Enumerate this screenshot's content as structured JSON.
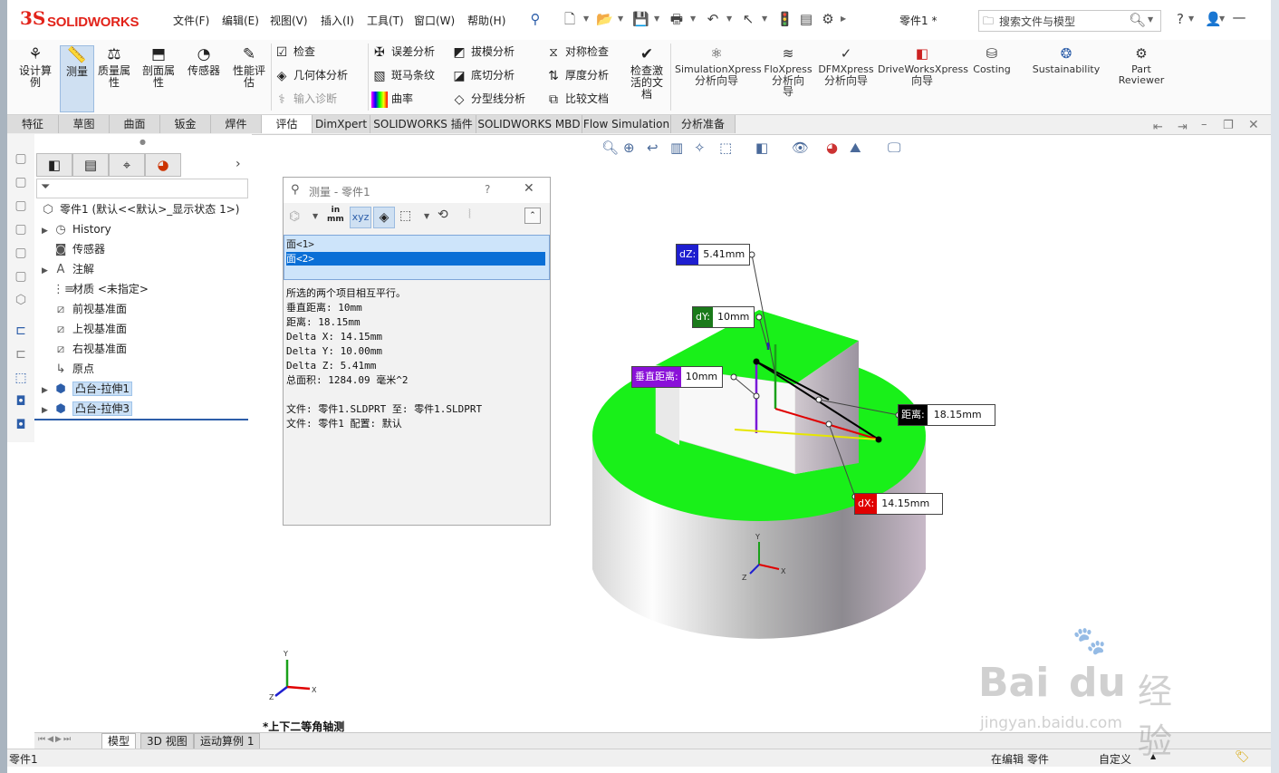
{
  "app": {
    "logo_prefix": "3S",
    "logo_text": "SOLIDWORKS",
    "document_title": "零件1 *"
  },
  "menu": [
    "文件(F)",
    "编辑(E)",
    "视图(V)",
    "插入(I)",
    "工具(T)",
    "窗口(W)",
    "帮助(H)"
  ],
  "search": {
    "placeholder": "搜索文件与模型"
  },
  "help_label": "?",
  "command_manager": {
    "big_buttons": [
      {
        "label": "设计算例",
        "icon": "design-study-icon"
      },
      {
        "label": "测量",
        "icon": "measure-icon"
      },
      {
        "label": "质量属性",
        "icon": "mass-properties-icon"
      },
      {
        "label": "剖面属性",
        "icon": "section-properties-icon"
      },
      {
        "label": "传感器",
        "icon": "sensor-icon"
      },
      {
        "label": "性能评估",
        "icon": "performance-evaluation-icon"
      }
    ],
    "small_buttons": [
      {
        "label": "检查",
        "icon": "check-icon"
      },
      {
        "label": "几何体分析",
        "icon": "geometry-analysis-icon"
      },
      {
        "label": "输入诊断",
        "icon": "import-diagnostics-icon"
      },
      {
        "label": "误差分析",
        "icon": "deviation-analysis-icon"
      },
      {
        "label": "斑马条纹",
        "icon": "zebra-stripes-icon"
      },
      {
        "label": "曲率",
        "icon": "curvature-icon"
      },
      {
        "label": "拔模分析",
        "icon": "draft-analysis-icon"
      },
      {
        "label": "底切分析",
        "icon": "undercut-analysis-icon"
      },
      {
        "label": "分型线分析",
        "icon": "parting-line-analysis-icon"
      },
      {
        "label": "对称检查",
        "icon": "symmetry-check-icon"
      },
      {
        "label": "厚度分析",
        "icon": "thickness-analysis-icon"
      },
      {
        "label": "比较文档",
        "icon": "compare-documents-icon"
      }
    ],
    "check_active_doc": "检查激活的文档",
    "extensions": [
      {
        "label": "SimulationXpress",
        "sub": "分析向导"
      },
      {
        "label": "FloXpress",
        "sub": "分析向导"
      },
      {
        "label": "DFMXpress",
        "sub": "分析向导"
      },
      {
        "label": "DriveWorksXpress",
        "sub": "向导"
      },
      {
        "label": "Costing",
        "sub": ""
      },
      {
        "label": "Sustainability",
        "sub": ""
      },
      {
        "label": "Part",
        "sub": "Reviewer"
      }
    ]
  },
  "tabs": [
    "特征",
    "草图",
    "曲面",
    "钣金",
    "焊件",
    "评估",
    "DimXpert",
    "SOLIDWORKS 插件",
    "SOLIDWORKS MBD",
    "Flow Simulation",
    "分析准备"
  ],
  "active_tab": "评估",
  "feature_tree": {
    "root": "零件1 (默认<<默认>_显示状态 1>)",
    "items": [
      {
        "label": "History",
        "icon": "history-icon",
        "expandable": true
      },
      {
        "label": "传感器",
        "icon": "sensor-folder-icon",
        "expandable": false
      },
      {
        "label": "注解",
        "icon": "annotations-icon",
        "expandable": true
      },
      {
        "label": "材质 <未指定>",
        "icon": "material-icon",
        "expandable": false
      },
      {
        "label": "前视基准面",
        "icon": "plane-icon",
        "expandable": false
      },
      {
        "label": "上视基准面",
        "icon": "plane-icon",
        "expandable": false
      },
      {
        "label": "右视基准面",
        "icon": "plane-icon",
        "expandable": false
      },
      {
        "label": "原点",
        "icon": "origin-icon",
        "expandable": false
      },
      {
        "label": "凸台-拉伸1",
        "icon": "extrude-icon",
        "expandable": true,
        "selected": true
      },
      {
        "label": "凸台-拉伸3",
        "icon": "extrude-icon",
        "expandable": true,
        "selected": true
      }
    ]
  },
  "measure_dialog": {
    "title": "测量 - 零件1",
    "help": "?",
    "unit_label_top": "in",
    "unit_label_bottom": "mm",
    "selections": [
      "面<1>",
      "面<2>"
    ],
    "results": [
      "所选的两个项目相互平行。",
      "垂直距离: 10mm",
      "距离: 18.15mm",
      "Delta X: 14.15mm",
      "Delta Y: 10.00mm",
      "Delta Z: 5.41mm",
      "总面积: 1284.09 毫米^2",
      "",
      "文件: 零件1.SLDPRT 至: 零件1.SLDPRT",
      "文件: 零件1 配置: 默认"
    ]
  },
  "callouts": {
    "dz": {
      "label": "dZ:",
      "value": "5.41mm",
      "color": "#1f1fd0"
    },
    "dy": {
      "label": "dY:",
      "value": "10mm",
      "color": "#1a7a1a"
    },
    "normal": {
      "label": "垂直距离:",
      "value": "10mm",
      "color": "#8a10d8"
    },
    "dist": {
      "label": "距离:",
      "value": "18.15mm",
      "color": "#000000"
    },
    "dx": {
      "label": "dX:",
      "value": "14.15mm",
      "color": "#e00000"
    }
  },
  "view_name": "*上下二等角轴测",
  "bottom_tabs": [
    "模型",
    "3D 视图",
    "运动算例 1"
  ],
  "status": {
    "left": "零件1",
    "editing": "在编辑 零件",
    "custom": "自定义"
  },
  "watermark": {
    "brand": "Bai",
    "brand2": "du",
    "cn": "经验",
    "url": "jingyan.baidu.com"
  },
  "colors": {
    "face_green": "#19f019",
    "accent_blue": "#2d5ea9",
    "logo_red": "#e2231a"
  }
}
